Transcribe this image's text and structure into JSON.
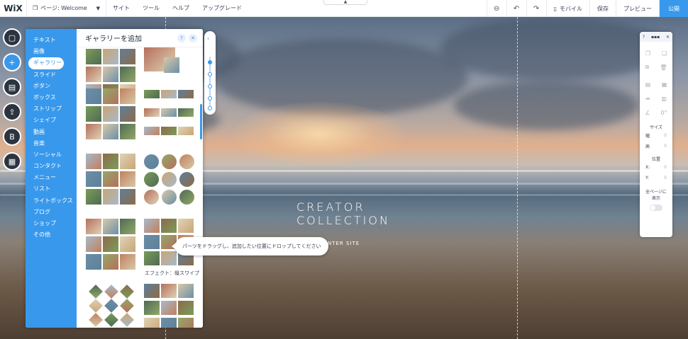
{
  "topbar": {
    "logo": "WiX",
    "page_selector": "ページ: Welcome",
    "menu": [
      "サイト",
      "ツール",
      "ヘルプ",
      "アップグレード"
    ],
    "mobile": "モバイル",
    "save": "保存",
    "preview": "プレビュー",
    "publish": "公開"
  },
  "hero": {
    "line1": "CREATOR",
    "line2": "COLLECTION",
    "sub": "NTER SITE"
  },
  "add_panel": {
    "title": "ギャラリーを追加",
    "categories": [
      "テキスト",
      "画像",
      "ギャラリー",
      "スライド",
      "ボタン",
      "ボックス",
      "ストリップ",
      "シェイプ",
      "動画",
      "音楽",
      "ソーシャル",
      "コンタクト",
      "メニュー",
      "リスト",
      "ライトボックス",
      "ブログ",
      "ショップ",
      "その他"
    ],
    "selected": "ギャラリー",
    "effect_caption": "エフェクト：縦スワイプ"
  },
  "tooltip": "パーツをドラッグし、追加したい位置にドロップしてください",
  "props_panel": {
    "size_label": "サイズ",
    "width_label": "幅",
    "width_value": "0",
    "height_label": "高",
    "height_value": "0",
    "position_label": "位置",
    "x_label": "X:",
    "x_value": "0",
    "y_label": "Y:",
    "y_value": "0",
    "angle_value": "0°",
    "show_all_label": "全ページに表示"
  },
  "colors": {
    "accent": "#3899ec",
    "dark": "#2b3440"
  }
}
